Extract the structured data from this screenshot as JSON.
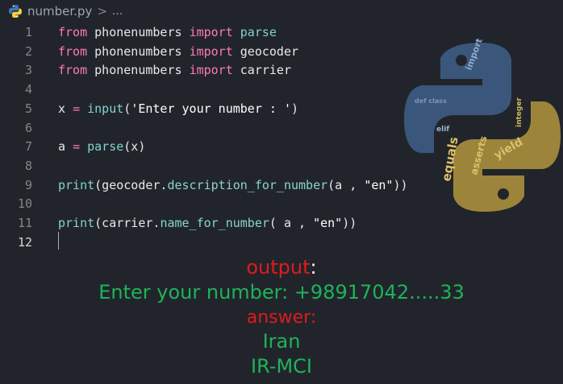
{
  "breadcrumb": {
    "filename": "number.py",
    "separator": ">",
    "more": "..."
  },
  "editor": {
    "lines": [
      {
        "n": "1",
        "tokens": [
          {
            "c": "kw",
            "t": "from"
          },
          {
            "c": "var",
            "t": " phonenumbers "
          },
          {
            "c": "kw",
            "t": "import"
          },
          {
            "c": "fn",
            "t": " parse"
          }
        ]
      },
      {
        "n": "2",
        "tokens": [
          {
            "c": "kw",
            "t": "from"
          },
          {
            "c": "var",
            "t": " phonenumbers "
          },
          {
            "c": "kw",
            "t": "import"
          },
          {
            "c": "var",
            "t": " geocoder"
          }
        ]
      },
      {
        "n": "3",
        "tokens": [
          {
            "c": "kw",
            "t": "from"
          },
          {
            "c": "var",
            "t": " phonenumbers "
          },
          {
            "c": "kw",
            "t": "import"
          },
          {
            "c": "var",
            "t": " carrier"
          }
        ]
      },
      {
        "n": "4",
        "tokens": []
      },
      {
        "n": "5",
        "tokens": [
          {
            "c": "var",
            "t": "x "
          },
          {
            "c": "kw",
            "t": "="
          },
          {
            "c": "var",
            "t": " "
          },
          {
            "c": "fn",
            "t": "input"
          },
          {
            "c": "var",
            "t": "("
          },
          {
            "c": "str",
            "t": "'Enter your number : '"
          },
          {
            "c": "var",
            "t": ")"
          }
        ]
      },
      {
        "n": "6",
        "tokens": []
      },
      {
        "n": "7",
        "tokens": [
          {
            "c": "var",
            "t": "a "
          },
          {
            "c": "kw",
            "t": "="
          },
          {
            "c": "var",
            "t": " "
          },
          {
            "c": "fn",
            "t": "parse"
          },
          {
            "c": "var",
            "t": "(x)"
          }
        ]
      },
      {
        "n": "8",
        "tokens": []
      },
      {
        "n": "9",
        "tokens": [
          {
            "c": "fn",
            "t": "print"
          },
          {
            "c": "var",
            "t": "(geocoder."
          },
          {
            "c": "meth",
            "t": "description_for_number"
          },
          {
            "c": "var",
            "t": "(a , "
          },
          {
            "c": "str",
            "t": "\"en\""
          },
          {
            "c": "var",
            "t": "))"
          }
        ]
      },
      {
        "n": "10",
        "tokens": []
      },
      {
        "n": "11",
        "tokens": [
          {
            "c": "fn",
            "t": "print"
          },
          {
            "c": "var",
            "t": "(carrier."
          },
          {
            "c": "meth",
            "t": "name_for_number"
          },
          {
            "c": "var",
            "t": "( a , "
          },
          {
            "c": "str",
            "t": "\"en\""
          },
          {
            "c": "var",
            "t": "))"
          }
        ]
      },
      {
        "n": "12",
        "tokens": []
      }
    ]
  },
  "output": {
    "title": "output",
    "title_colon": ":",
    "input_line": "Enter your number: +98917042.....33",
    "answer_label": "answer:",
    "result_country": "Iran",
    "result_carrier": "IR-MCI"
  },
  "colors": {
    "background": "#21252b",
    "keyword": "#ff7ab2",
    "builtin": "#82d2ce",
    "output_red": "#e01b1b",
    "output_green": "#1fb25a"
  },
  "icons": {
    "file": "python-icon",
    "logo": "python-logo-wordcloud"
  }
}
